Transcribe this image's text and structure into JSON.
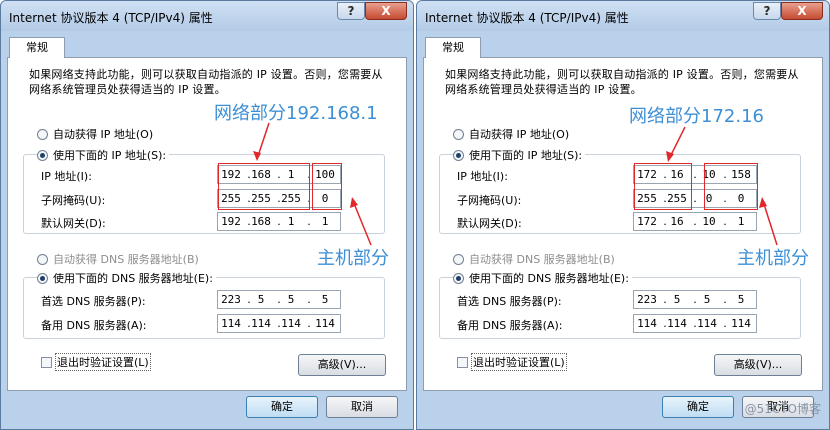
{
  "dialogs": [
    {
      "title": "Internet 协议版本 4 (TCP/IPv4) 属性",
      "help_label": "?",
      "close_label": "X",
      "tab_label": "常规",
      "intro_text": "如果网络支持此功能，则可以获取自动指派的 IP 设置。否则，您需要从网络系统管理员处获得适当的 IP 设置。",
      "radio_auto_ip": "自动获得 IP 地址(O)",
      "radio_manual_ip": "使用下面的 IP 地址(S):",
      "label_ip": "IP 地址(I):",
      "label_mask": "子网掩码(U):",
      "label_gateway": "默认网关(D):",
      "ip": [
        "192",
        "168",
        "1",
        "100"
      ],
      "mask": [
        "255",
        "255",
        "255",
        "0"
      ],
      "gateway": [
        "192",
        "168",
        "1",
        "1"
      ],
      "radio_auto_dns": "自动获得 DNS 服务器地址(B)",
      "radio_manual_dns": "使用下面的 DNS 服务器地址(E):",
      "label_dns1": "首选 DNS 服务器(P):",
      "label_dns2": "备用 DNS 服务器(A):",
      "dns1": [
        "223",
        "5",
        "5",
        "5"
      ],
      "dns2": [
        "114",
        "114",
        "114",
        "114"
      ],
      "checkbox_label": "退出时验证设置(L)",
      "advanced_label": "高级(V)...",
      "ok_label": "确定",
      "cancel_label": "取消",
      "annotation_network": "网络部分192.168.1",
      "annotation_host": "主机部分",
      "watermark": ""
    },
    {
      "title": "Internet 协议版本 4 (TCP/IPv4) 属性",
      "help_label": "?",
      "close_label": "X",
      "tab_label": "常规",
      "intro_text": "如果网络支持此功能，则可以获取自动指派的 IP 设置。否则，您需要从网络系统管理员处获得适当的 IP 设置。",
      "radio_auto_ip": "自动获得 IP 地址(O)",
      "radio_manual_ip": "使用下面的 IP 地址(S):",
      "label_ip": "IP 地址(I):",
      "label_mask": "子网掩码(U):",
      "label_gateway": "默认网关(D):",
      "ip": [
        "172",
        "16",
        "10",
        "158"
      ],
      "mask": [
        "255",
        "255",
        "0",
        "0"
      ],
      "gateway": [
        "172",
        "16",
        "10",
        "1"
      ],
      "radio_auto_dns": "自动获得 DNS 服务器地址(B)",
      "radio_manual_dns": "使用下面的 DNS 服务器地址(E):",
      "label_dns1": "首选 DNS 服务器(P):",
      "label_dns2": "备用 DNS 服务器(A):",
      "dns1": [
        "223",
        "5",
        "5",
        "5"
      ],
      "dns2": [
        "114",
        "114",
        "114",
        "114"
      ],
      "checkbox_label": "退出时验证设置(L)",
      "advanced_label": "高级(V)...",
      "ok_label": "确定",
      "cancel_label": "取消",
      "annotation_network": "网络部分172.16",
      "annotation_host": "主机部分",
      "watermark": "@51CTO博客"
    }
  ],
  "colors": {
    "annotation_text": "#3d8fd6",
    "annotation_box": "#e0282c",
    "dialog_frame": "#b9d1ea"
  }
}
